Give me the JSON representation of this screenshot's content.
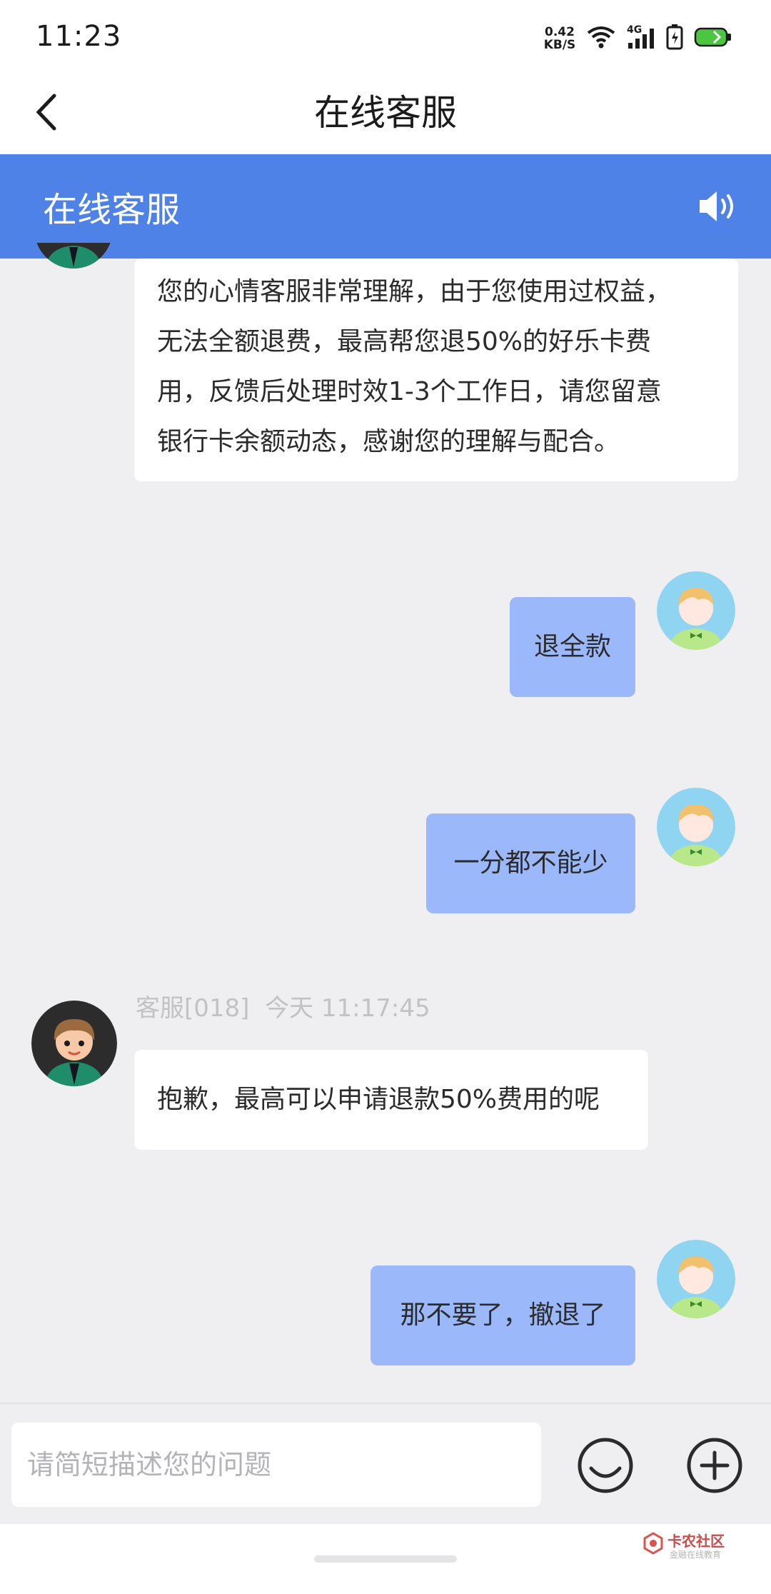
{
  "status_bar": {
    "time": "11:23",
    "net_speed_value": "0.42",
    "net_speed_unit": "KB/S",
    "network_type": "4G",
    "icons": [
      "wifi-icon",
      "signal-icon",
      "battery-saver-icon",
      "battery-icon"
    ]
  },
  "header": {
    "title": "在线客服",
    "back_icon": "chevron-left-icon"
  },
  "banner": {
    "title": "在线客服",
    "speaker_icon": "speaker-icon",
    "color": "#4f82e6"
  },
  "messages": [
    {
      "from": "agent",
      "text": "您的心情客服非常理解，由于您使用过权益，无法全额退费，最高帮您退50%的好乐卡费用，反馈后处理时效1-3个工作日，请您留意银行卡余额动态，感谢您的理解与配合。",
      "lines": [
        "您的心情客服非常理解，由于您使用过权益，",
        "无法全额退费，最高帮您退50%的好乐卡费",
        "用，反馈后处理时效1-3个工作日，请您留意",
        "银行卡余额动态，感谢您的理解与配合。"
      ]
    },
    {
      "from": "user",
      "text": "退全款"
    },
    {
      "from": "user",
      "text": "一分都不能少"
    },
    {
      "from": "agent",
      "sender": "客服[018]",
      "time": "今天 11:17:45",
      "text": "抱歉，最高可以申请退款50%费用的呢"
    },
    {
      "from": "user",
      "text": "那不要了，撤退了"
    }
  ],
  "input": {
    "placeholder": "请简短描述您的问题",
    "value": ""
  },
  "toolbar": {
    "emoji_icon": "smiley-icon",
    "add_icon": "plus-circle-icon"
  },
  "watermark": {
    "title": "卡农社区",
    "subtitle": "金融在线教育"
  },
  "colors": {
    "user_bubble": "#9bb8fb",
    "agent_bubble": "#ffffff",
    "background": "#efeff2"
  }
}
